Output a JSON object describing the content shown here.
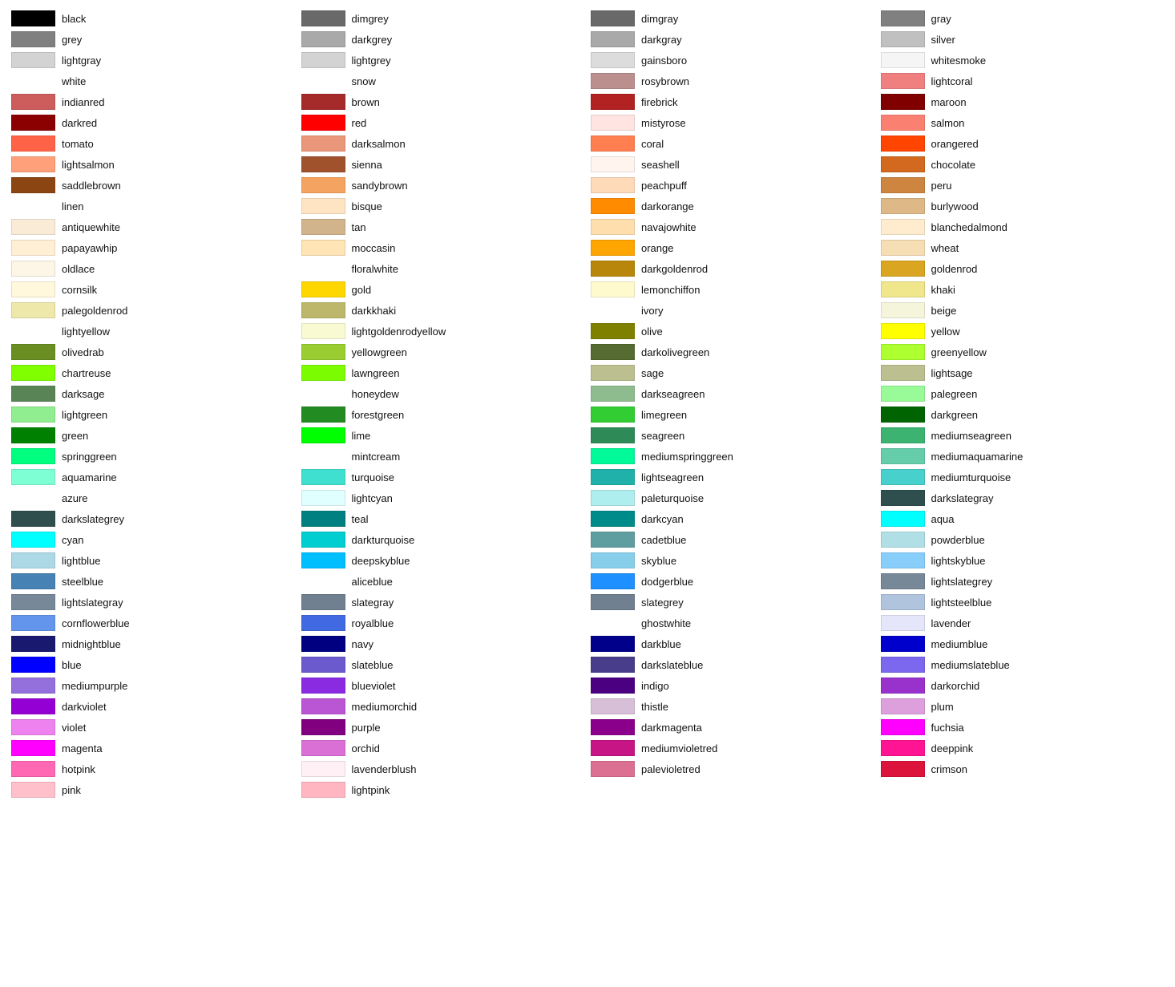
{
  "columns": [
    [
      {
        "name": "black",
        "color": "#000000"
      },
      {
        "name": "grey",
        "color": "#808080"
      },
      {
        "name": "lightgray",
        "color": "#d3d3d3"
      },
      {
        "name": "white",
        "color": null
      },
      {
        "name": "indianred",
        "color": "#cd5c5c"
      },
      {
        "name": "darkred",
        "color": "#8b0000"
      },
      {
        "name": "tomato",
        "color": "#ff6347"
      },
      {
        "name": "lightsalmon",
        "color": "#ffa07a"
      },
      {
        "name": "saddlebrown",
        "color": "#8b4513"
      },
      {
        "name": "linen",
        "color": null
      },
      {
        "name": "antiquewhite",
        "color": "#faebd7"
      },
      {
        "name": "papayawhip",
        "color": "#ffefd5"
      },
      {
        "name": "oldlace",
        "color": "#fdf5e6"
      },
      {
        "name": "cornsilk",
        "color": "#fff8dc"
      },
      {
        "name": "palegoldenrod",
        "color": "#eee8aa"
      },
      {
        "name": "lightyellow",
        "color": null
      },
      {
        "name": "olivedrab",
        "color": "#6b8e23"
      },
      {
        "name": "chartreuse",
        "color": "#7fff00"
      },
      {
        "name": "darksage",
        "color": "#598556"
      },
      {
        "name": "lightgreen",
        "color": "#90ee90"
      },
      {
        "name": "green",
        "color": "#008000"
      },
      {
        "name": "springgreen",
        "color": "#00ff7f"
      },
      {
        "name": "aquamarine",
        "color": "#7fffd4"
      },
      {
        "name": "azure",
        "color": null
      },
      {
        "name": "darkslategrey",
        "color": "#2f4f4f"
      },
      {
        "name": "cyan",
        "color": "#00ffff"
      },
      {
        "name": "lightblue",
        "color": "#add8e6"
      },
      {
        "name": "steelblue",
        "color": "#4682b4"
      },
      {
        "name": "lightslategray",
        "color": "#778899"
      },
      {
        "name": "cornflowerblue",
        "color": "#6495ed"
      },
      {
        "name": "midnightblue",
        "color": "#191970"
      },
      {
        "name": "blue",
        "color": "#0000ff"
      },
      {
        "name": "mediumpurple",
        "color": "#9370db"
      },
      {
        "name": "darkviolet",
        "color": "#9400d3"
      },
      {
        "name": "violet",
        "color": "#ee82ee"
      },
      {
        "name": "magenta",
        "color": "#ff00ff"
      },
      {
        "name": "hotpink",
        "color": "#ff69b4"
      },
      {
        "name": "pink",
        "color": "#ffc0cb"
      }
    ],
    [
      {
        "name": "dimgrey",
        "color": "#696969"
      },
      {
        "name": "darkgrey",
        "color": "#a9a9a9"
      },
      {
        "name": "lightgrey",
        "color": "#d3d3d3"
      },
      {
        "name": "snow",
        "color": null
      },
      {
        "name": "brown",
        "color": "#a52a2a"
      },
      {
        "name": "red",
        "color": "#ff0000"
      },
      {
        "name": "darksalmon",
        "color": "#e9967a"
      },
      {
        "name": "sienna",
        "color": "#a0522d"
      },
      {
        "name": "sandybrown",
        "color": "#f4a460"
      },
      {
        "name": "bisque",
        "color": "#ffe4c4"
      },
      {
        "name": "tan",
        "color": "#d2b48c"
      },
      {
        "name": "moccasin",
        "color": "#ffe4b5"
      },
      {
        "name": "floralwhite",
        "color": null
      },
      {
        "name": "gold",
        "color": "#ffd700"
      },
      {
        "name": "darkkhaki",
        "color": "#bdb76b"
      },
      {
        "name": "lightgoldenrodyellow",
        "color": "#fafad2"
      },
      {
        "name": "yellowgreen",
        "color": "#9acd32"
      },
      {
        "name": "lawngreen",
        "color": "#7cfc00"
      },
      {
        "name": "honeydew",
        "color": null
      },
      {
        "name": "forestgreen",
        "color": "#228b22"
      },
      {
        "name": "lime",
        "color": "#00ff00"
      },
      {
        "name": "mintcream",
        "color": null
      },
      {
        "name": "turquoise",
        "color": "#40e0d0"
      },
      {
        "name": "lightcyan",
        "color": "#e0ffff"
      },
      {
        "name": "teal",
        "color": "#008080"
      },
      {
        "name": "darkturquoise",
        "color": "#00ced1"
      },
      {
        "name": "deepskyblue",
        "color": "#00bfff"
      },
      {
        "name": "aliceblue",
        "color": null
      },
      {
        "name": "slategray",
        "color": "#708090"
      },
      {
        "name": "royalblue",
        "color": "#4169e1"
      },
      {
        "name": "navy",
        "color": "#000080"
      },
      {
        "name": "slateblue",
        "color": "#6a5acd"
      },
      {
        "name": "blueviolet",
        "color": "#8a2be2"
      },
      {
        "name": "mediumorchid",
        "color": "#ba55d3"
      },
      {
        "name": "purple",
        "color": "#800080"
      },
      {
        "name": "orchid",
        "color": "#da70d6"
      },
      {
        "name": "lavenderblush",
        "color": "#fff0f5"
      },
      {
        "name": "lightpink",
        "color": "#ffb6c1"
      }
    ],
    [
      {
        "name": "dimgray",
        "color": "#696969"
      },
      {
        "name": "darkgray",
        "color": "#a9a9a9"
      },
      {
        "name": "gainsboro",
        "color": "#dcdcdc"
      },
      {
        "name": "rosybrown",
        "color": "#bc8f8f"
      },
      {
        "name": "firebrick",
        "color": "#b22222"
      },
      {
        "name": "mistyrose",
        "color": "#ffe4e1"
      },
      {
        "name": "coral",
        "color": "#ff7f50"
      },
      {
        "name": "seashell",
        "color": "#fff5ee"
      },
      {
        "name": "peachpuff",
        "color": "#ffdab9"
      },
      {
        "name": "darkorange",
        "color": "#ff8c00"
      },
      {
        "name": "navajowhite",
        "color": "#ffdead"
      },
      {
        "name": "orange",
        "color": "#ffa500"
      },
      {
        "name": "darkgoldenrod",
        "color": "#b8860b"
      },
      {
        "name": "lemonchiffon",
        "color": "#fffacd"
      },
      {
        "name": "ivory",
        "color": null
      },
      {
        "name": "olive",
        "color": "#808000"
      },
      {
        "name": "darkolivegreen",
        "color": "#556b2f"
      },
      {
        "name": "sage",
        "color": "#bcbf8f"
      },
      {
        "name": "darkseagreen",
        "color": "#8fbc8f"
      },
      {
        "name": "limegreen",
        "color": "#32cd32"
      },
      {
        "name": "seagreen",
        "color": "#2e8b57"
      },
      {
        "name": "mediumspringgreen",
        "color": "#00fa9a"
      },
      {
        "name": "lightseagreen",
        "color": "#20b2aa"
      },
      {
        "name": "paleturquoise",
        "color": "#afeeee"
      },
      {
        "name": "darkcyan",
        "color": "#008b8b"
      },
      {
        "name": "cadetblue",
        "color": "#5f9ea0"
      },
      {
        "name": "skyblue",
        "color": "#87ceeb"
      },
      {
        "name": "dodgerblue",
        "color": "#1e90ff"
      },
      {
        "name": "slategrey",
        "color": "#708090"
      },
      {
        "name": "ghostwhite",
        "color": null
      },
      {
        "name": "darkblue",
        "color": "#00008b"
      },
      {
        "name": "darkslateblue",
        "color": "#483d8b"
      },
      {
        "name": "indigo",
        "color": "#4b0082"
      },
      {
        "name": "thistle",
        "color": "#d8bfd8"
      },
      {
        "name": "darkmagenta",
        "color": "#8b008b"
      },
      {
        "name": "mediumvioletred",
        "color": "#c71585"
      },
      {
        "name": "palevioletred",
        "color": "#db7093"
      }
    ],
    [
      {
        "name": "gray",
        "color": "#808080"
      },
      {
        "name": "silver",
        "color": "#c0c0c0"
      },
      {
        "name": "whitesmoke",
        "color": "#f5f5f5"
      },
      {
        "name": "lightcoral",
        "color": "#f08080"
      },
      {
        "name": "maroon",
        "color": "#800000"
      },
      {
        "name": "salmon",
        "color": "#fa8072"
      },
      {
        "name": "orangered",
        "color": "#ff4500"
      },
      {
        "name": "chocolate",
        "color": "#d2691e"
      },
      {
        "name": "peru",
        "color": "#cd853f"
      },
      {
        "name": "burlywood",
        "color": "#deb887"
      },
      {
        "name": "blanchedalmond",
        "color": "#ffebcd"
      },
      {
        "name": "wheat",
        "color": "#f5deb3"
      },
      {
        "name": "goldenrod",
        "color": "#daa520"
      },
      {
        "name": "khaki",
        "color": "#f0e68c"
      },
      {
        "name": "beige",
        "color": "#f5f5dc"
      },
      {
        "name": "yellow",
        "color": "#ffff00"
      },
      {
        "name": "greenyellow",
        "color": "#adff2f"
      },
      {
        "name": "lightsage",
        "color": "#bcbf8f"
      },
      {
        "name": "palegreen",
        "color": "#98fb98"
      },
      {
        "name": "darkgreen",
        "color": "#006400"
      },
      {
        "name": "mediumseagreen",
        "color": "#3cb371"
      },
      {
        "name": "mediumaquamarine",
        "color": "#66cdaa"
      },
      {
        "name": "mediumturquoise",
        "color": "#48d1cc"
      },
      {
        "name": "darkslategray",
        "color": "#2f4f4f"
      },
      {
        "name": "aqua",
        "color": "#00ffff"
      },
      {
        "name": "powderblue",
        "color": "#b0e0e6"
      },
      {
        "name": "lightskyblue",
        "color": "#87cefa"
      },
      {
        "name": "lightslategrey",
        "color": "#778899"
      },
      {
        "name": "lightsteelblue",
        "color": "#b0c4de"
      },
      {
        "name": "lavender",
        "color": "#e6e6fa"
      },
      {
        "name": "mediumblue",
        "color": "#0000cd"
      },
      {
        "name": "mediumslateblue",
        "color": "#7b68ee"
      },
      {
        "name": "darkorchid",
        "color": "#9932cc"
      },
      {
        "name": "plum",
        "color": "#dda0dd"
      },
      {
        "name": "fuchsia",
        "color": "#ff00ff"
      },
      {
        "name": "deeppink",
        "color": "#ff1493"
      },
      {
        "name": "crimson",
        "color": "#dc143c"
      }
    ]
  ]
}
